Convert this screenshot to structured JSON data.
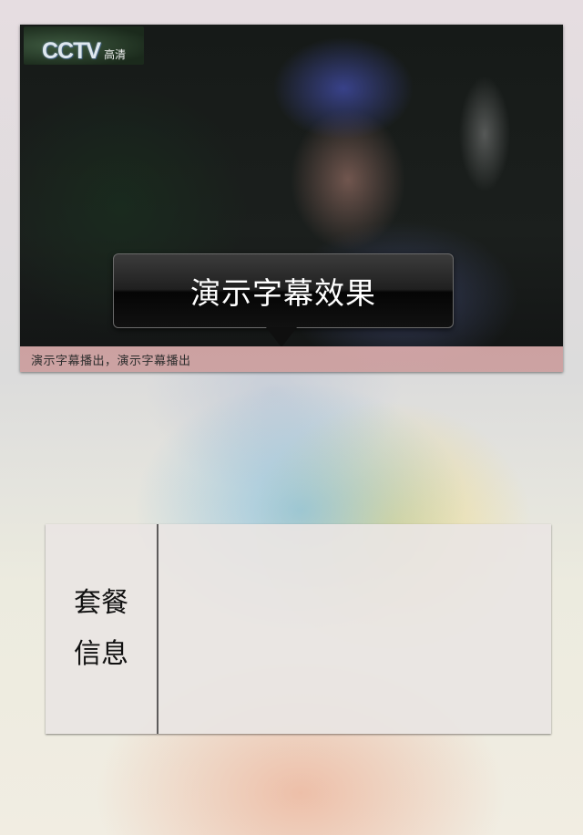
{
  "video": {
    "logo": {
      "brand": "CCTV",
      "sub": "高清"
    },
    "bubble_text": "演示字幕效果",
    "ticker_text": "演示字幕播出，演示字幕播出"
  },
  "package_panel": {
    "label_line1": "套餐",
    "label_line2": "信息"
  }
}
